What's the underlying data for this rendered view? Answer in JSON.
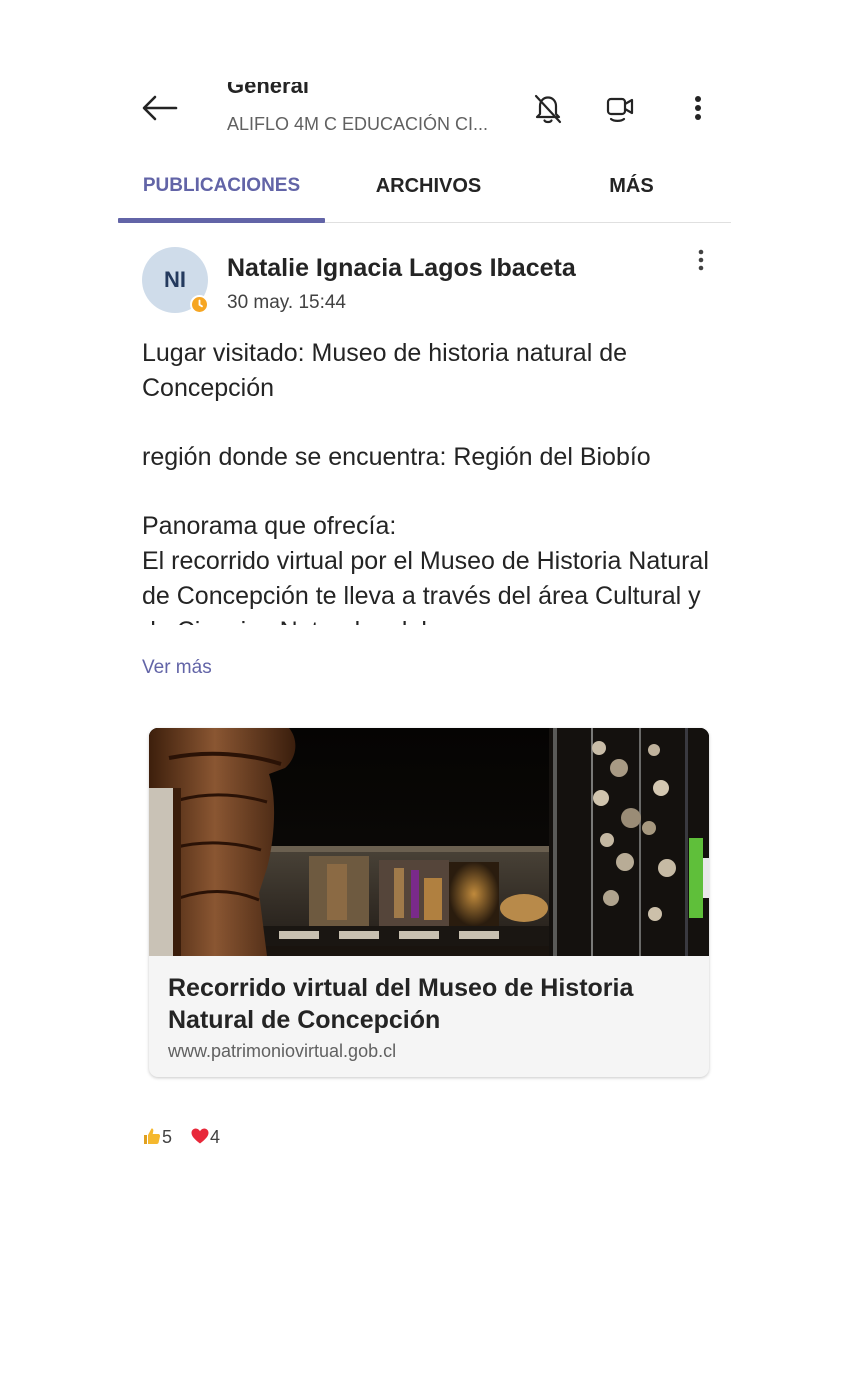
{
  "header": {
    "channel_name": "General",
    "team_name": "ALIFLO 4M C EDUCACIÓN CI...",
    "icons": [
      "back-arrow-icon",
      "bell-off-icon",
      "video-call-icon",
      "more-vertical-icon"
    ]
  },
  "tabs": [
    {
      "label": "PUBLICACIONES",
      "active": true
    },
    {
      "label": "ARCHIVOS",
      "active": false
    },
    {
      "label": "MÁS",
      "active": false
    }
  ],
  "post": {
    "avatar_initials": "NI",
    "author": "Natalie Ignacia Lagos Ibaceta",
    "timestamp": "30 may. 15:44",
    "paragraphs": [
      "Lugar visitado: Museo de historia natural de Concepción",
      "región donde se encuentra: Región del Biobío",
      "Panorama que ofrecía:",
      "El recorrido virtual por el Museo de Historia Natural de Concepción te lleva a través del área Cultural y de Ciencias Naturales del"
    ],
    "see_more_label": "Ver más"
  },
  "link_card": {
    "title": "Recorrido virtual del Museo de Historia Natural de Concepción",
    "url": "www.patrimoniovirtual.gob.cl"
  },
  "reactions": [
    {
      "icon": "thumbs-up-icon",
      "count": "5"
    },
    {
      "icon": "heart-icon",
      "count": "4"
    }
  ],
  "colors": {
    "accent": "#6264a7",
    "presence_away": "#f6a623",
    "avatar_bg": "#cfdcea",
    "heart": "#e8283a",
    "like": "#f5b82e"
  }
}
